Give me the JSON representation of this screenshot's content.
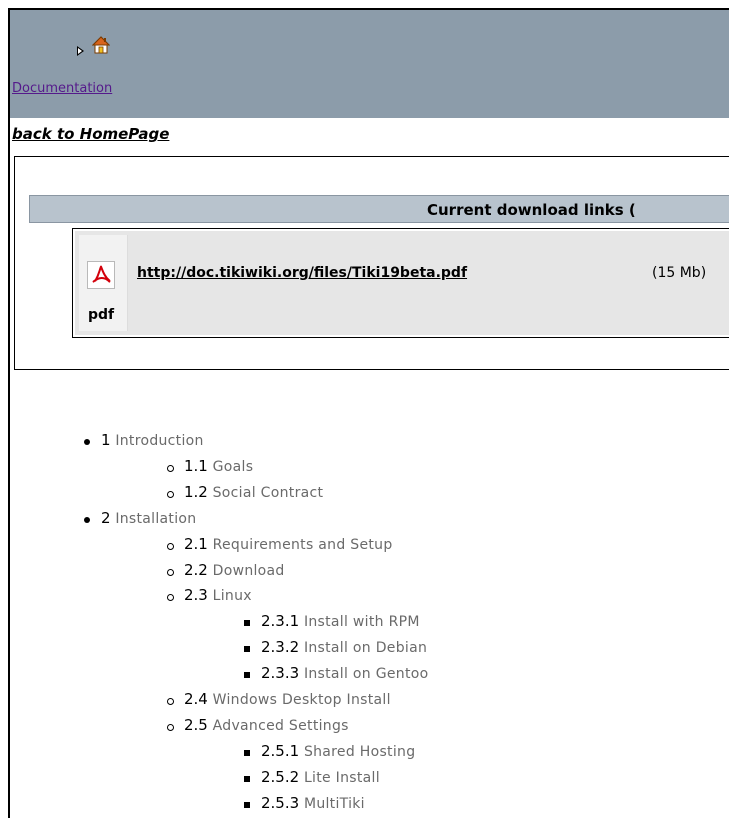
{
  "nav": {
    "documentation_label": "Documentation"
  },
  "back_link": "back to HomePage",
  "downloads": {
    "header": "Current download links (",
    "item": {
      "icon_label": "pdf",
      "link": "http://doc.tikiwiki.org/files/Tiki19beta.pdf",
      "size": "(15 Mb)"
    }
  },
  "toc": [
    {
      "num": "1",
      "title": "Introduction",
      "level": 1
    },
    {
      "num": "1.1",
      "title": "Goals",
      "level": 2
    },
    {
      "num": "1.2",
      "title": "Social Contract",
      "level": 2
    },
    {
      "num": "2",
      "title": "Installation",
      "level": 1
    },
    {
      "num": "2.1",
      "title": "Requirements and Setup",
      "level": 2
    },
    {
      "num": "2.2",
      "title": "Download",
      "level": 2
    },
    {
      "num": "2.3",
      "title": "Linux",
      "level": 2
    },
    {
      "num": "2.3.1",
      "title": "Install with RPM",
      "level": 3
    },
    {
      "num": "2.3.2",
      "title": "Install on Debian",
      "level": 3
    },
    {
      "num": "2.3.3",
      "title": "Install on Gentoo",
      "level": 3
    },
    {
      "num": "2.4",
      "title": "Windows Desktop Install",
      "level": 2
    },
    {
      "num": "2.5",
      "title": "Advanced Settings",
      "level": 2
    },
    {
      "num": "2.5.1",
      "title": "Shared Hosting",
      "level": 3
    },
    {
      "num": "2.5.2",
      "title": "Lite Install",
      "level": 3
    },
    {
      "num": "2.5.3",
      "title": "MultiTiki",
      "level": 3
    }
  ],
  "colors": {
    "topbar": "#8c9caa",
    "header_bar": "#b8c3cd",
    "toc_title": "#6a6a6a"
  },
  "icons": [
    "expand-arrow-icon",
    "home-icon",
    "pdf-icon"
  ]
}
